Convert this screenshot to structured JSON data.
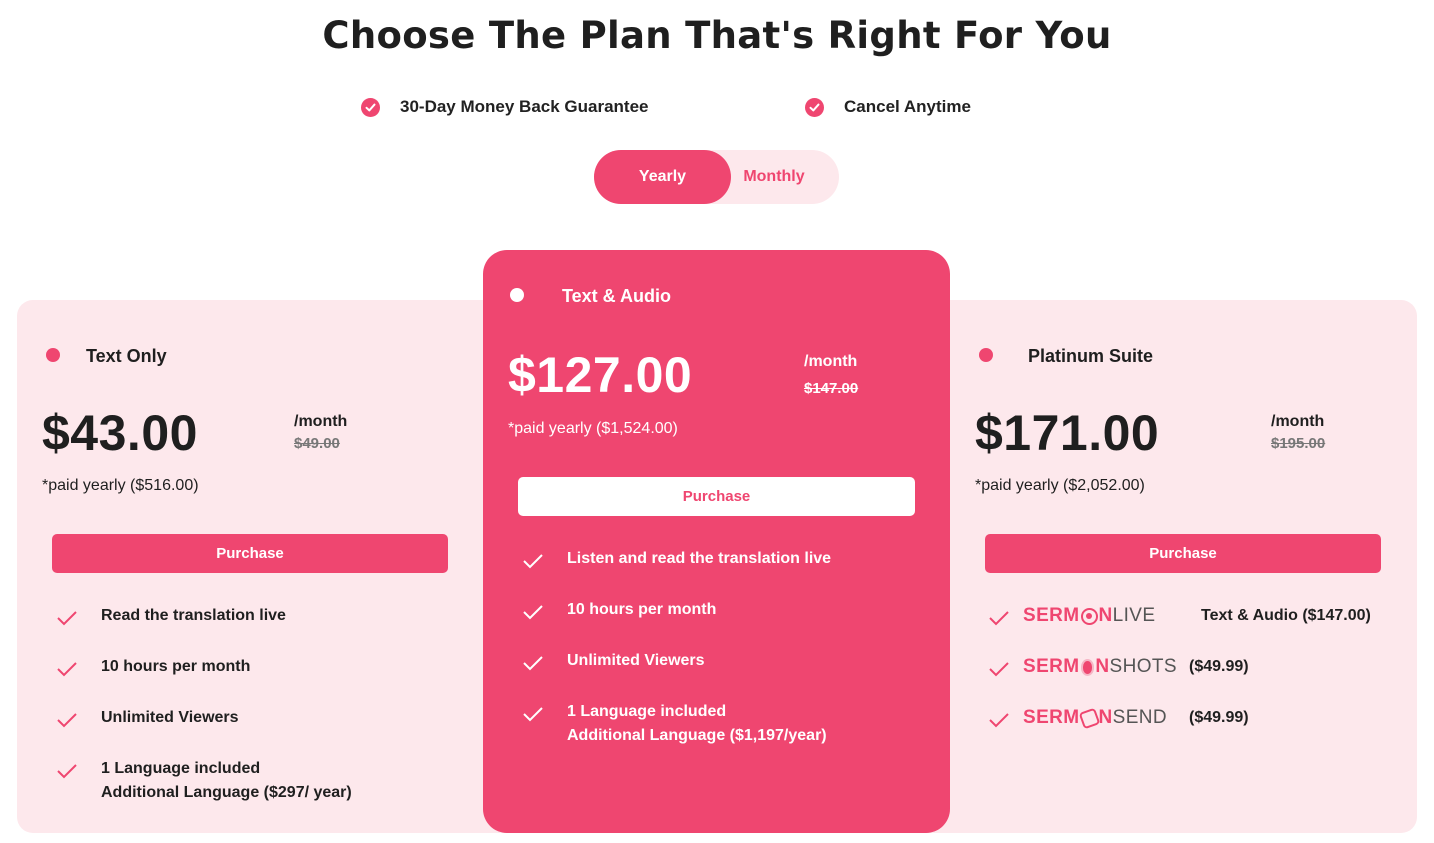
{
  "header": {
    "title": "Choose The Plan That's Right For You",
    "guarantees": [
      "30-Day Money Back Guarantee",
      "Cancel Anytime"
    ]
  },
  "billing_toggle": {
    "yearly": "Yearly",
    "monthly": "Monthly",
    "selected": "Yearly"
  },
  "plans": [
    {
      "name": "Text Only",
      "price": "$43.00",
      "per": "/month",
      "old_price": "$49.00",
      "paid_yearly": "*paid yearly ($516.00)",
      "button": "Purchase",
      "features": [
        "Read the translation live",
        "10 hours per month",
        "Unlimited Viewers",
        "1 Language included",
        "Additional Language ($297/ year)"
      ]
    },
    {
      "name": "Text & Audio",
      "price": "$127.00",
      "per": "/month",
      "old_price": "$147.00",
      "paid_yearly": "*paid yearly ($1,524.00)",
      "button": "Purchase",
      "features": [
        "Listen and read the translation live",
        "10 hours per month",
        "Unlimited Viewers",
        "1 Language included",
        "Additional Language ($1,197/year)"
      ]
    },
    {
      "name": "Platinum Suite",
      "price": "$171.00",
      "per": "/month",
      "old_price": "$195.00",
      "paid_yearly": "*paid yearly ($2,052.00)",
      "button": "Purchase",
      "bundle": [
        {
          "brand_a": "SERM",
          "brand_b": "LIVE",
          "brand_a_suffix": "N",
          "detail": "Text & Audio ($147.00)"
        },
        {
          "brand_a": "SERM",
          "brand_b": "SHOTS",
          "brand_a_suffix": "N",
          "detail": "($49.99)"
        },
        {
          "brand_a": "SERM",
          "brand_b": "SEND",
          "brand_a_suffix": "N",
          "detail": "($49.99)"
        }
      ]
    }
  ],
  "colors": {
    "accent": "#ef4670",
    "panel": "#fde8ec",
    "text": "#1f1f1f",
    "muted": "#777777"
  }
}
